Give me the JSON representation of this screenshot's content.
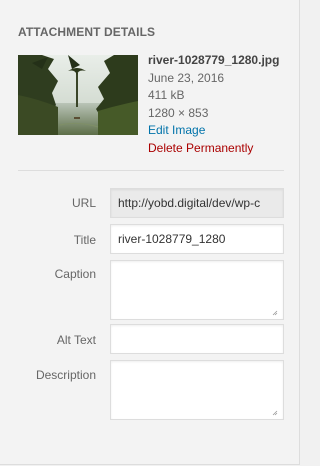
{
  "heading": "ATTACHMENT DETAILS",
  "file": {
    "name": "river-1028779_1280.jpg",
    "date": "June 23, 2016",
    "size": "411 kB",
    "dimensions": "1280 × 853",
    "edit_label": "Edit Image",
    "delete_label": "Delete Permanently"
  },
  "fields": {
    "url": {
      "label": "URL",
      "value": "http://yobd.digital/dev/wp-c"
    },
    "title": {
      "label": "Title",
      "value": "river-1028779_1280"
    },
    "caption": {
      "label": "Caption",
      "value": ""
    },
    "alt": {
      "label": "Alt Text",
      "value": ""
    },
    "description": {
      "label": "Description",
      "value": ""
    }
  },
  "colors": {
    "link": "#0073aa",
    "delete": "#aa0000",
    "panel_bg": "#f3f3f3"
  }
}
